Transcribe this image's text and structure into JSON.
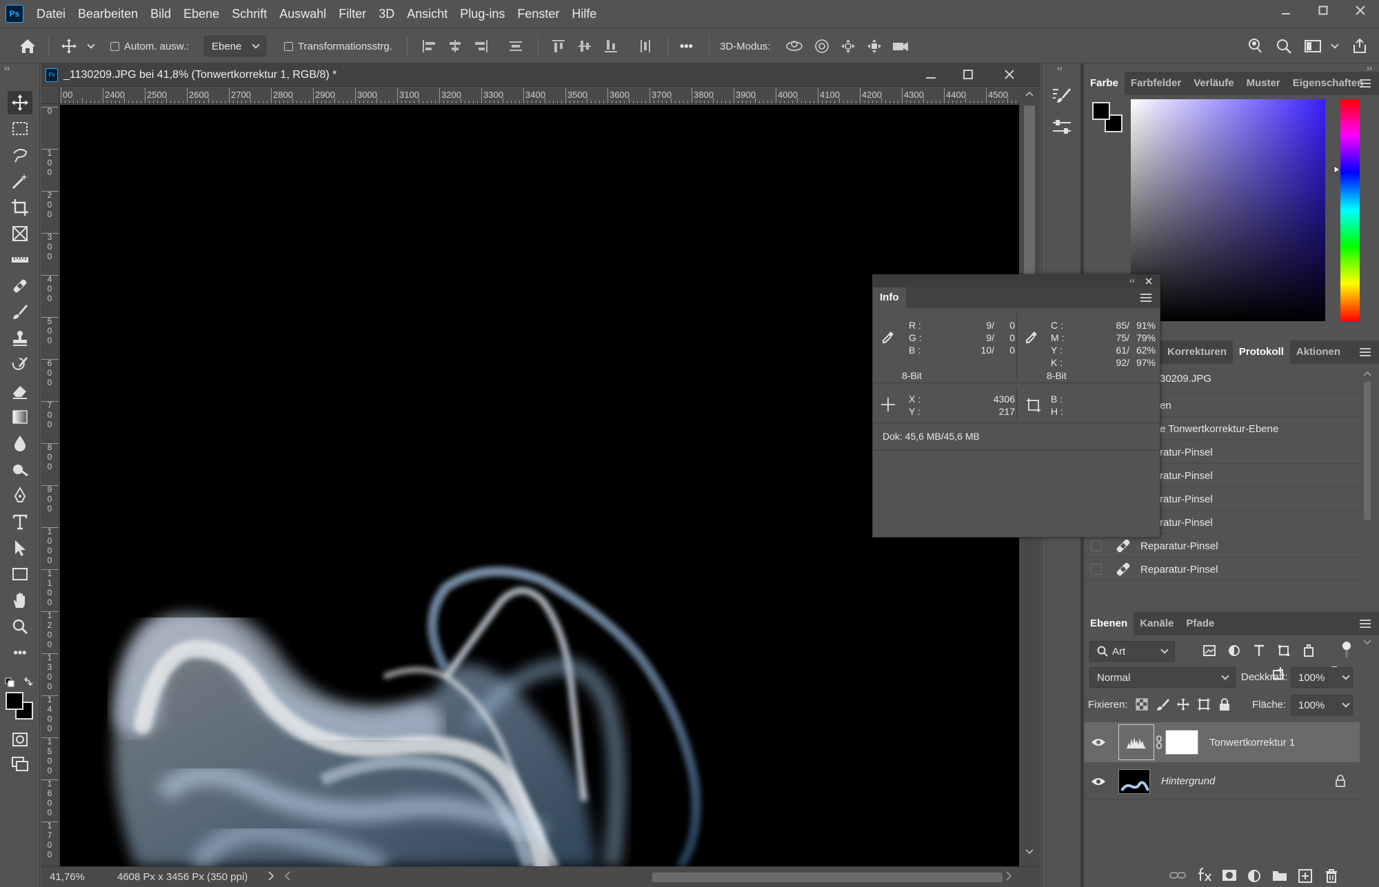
{
  "menu": {
    "logo": "Ps",
    "items": [
      "Datei",
      "Bearbeiten",
      "Bild",
      "Ebene",
      "Schrift",
      "Auswahl",
      "Filter",
      "3D",
      "Ansicht",
      "Plug-ins",
      "Fenster",
      "Hilfe"
    ]
  },
  "options": {
    "auto_select_label": "Autom. ausw.:",
    "auto_select_target": "Ebene",
    "transform_label": "Transformationsstrg.",
    "mode_3d_label": "3D-Modus:",
    "more": "•••"
  },
  "document": {
    "title": "_1130209.JPG bei 41,8% (Tonwertkorrektur 1, RGB/8) *",
    "zoom": "41,76%",
    "dimensions": "4608 Px x 3456 Px (350 ppi)",
    "ruler_top_labels": [
      "00",
      "2400",
      "2500",
      "2600",
      "2700",
      "2800",
      "2900",
      "3000",
      "3100",
      "3200",
      "3300",
      "3400",
      "3500",
      "3600",
      "3700",
      "3800",
      "3900",
      "4000",
      "4100",
      "4200",
      "4300",
      "4400",
      "4500"
    ],
    "ruler_left_labels": [
      "0",
      "100",
      "200",
      "300",
      "400",
      "500",
      "600",
      "700",
      "800",
      "900",
      "1000",
      "1100",
      "1200",
      "1300",
      "1400",
      "1500",
      "1600",
      "1700"
    ]
  },
  "color_panel": {
    "tabs": [
      "Farbe",
      "Farbfelder",
      "Verläufe",
      "Muster",
      "Eigenschaften"
    ],
    "active_tab": "Farbe",
    "hue_color": "#3a1fff"
  },
  "history_panel": {
    "tabs": [
      "Korrekturen",
      "Protokoll",
      "Aktionen"
    ],
    "active_tab": "Protokoll",
    "snapshot": "30209.JPG",
    "items": [
      "en",
      "e Tonwertkorrektur-Ebene",
      "ratur-Pinsel",
      "ratur-Pinsel",
      "ratur-Pinsel",
      "ratur-Pinsel",
      "Reparatur-Pinsel",
      "Reparatur-Pinsel"
    ]
  },
  "info_panel": {
    "tab": "Info",
    "rgb": {
      "labels": [
        "R :",
        "G :",
        "B :"
      ],
      "values": [
        "9/",
        "9/",
        "10/"
      ],
      "values2": [
        "0",
        "0",
        "0"
      ],
      "bits": "8-Bit"
    },
    "cmyk": {
      "labels": [
        "C :",
        "M :",
        "Y :",
        "K :"
      ],
      "values": [
        "85/",
        "75/",
        "61/",
        "92/"
      ],
      "values2": [
        "91%",
        "79%",
        "62%",
        "97%"
      ],
      "bits": "8-Bit"
    },
    "xy": {
      "labels": [
        "X :",
        "Y :"
      ],
      "values": [
        "4306",
        "217"
      ]
    },
    "bh": {
      "labels": [
        "B :",
        "H :"
      ]
    },
    "doc": "Dok: 45,6 MB/45,6 MB"
  },
  "layers_panel": {
    "tabs": [
      "Ebenen",
      "Kanäle",
      "Pfade"
    ],
    "active_tab": "Ebenen",
    "filter": "Art",
    "blend_mode": "Normal",
    "opacity_label": "Deckkraft:",
    "opacity": "100%",
    "lock_label": "Fixieren:",
    "fill_label": "Fläche:",
    "fill": "100%",
    "layers": [
      {
        "name": "Tonwertkorrektur 1",
        "selected": true
      },
      {
        "name": "Hintergrund",
        "selected": false
      }
    ]
  }
}
